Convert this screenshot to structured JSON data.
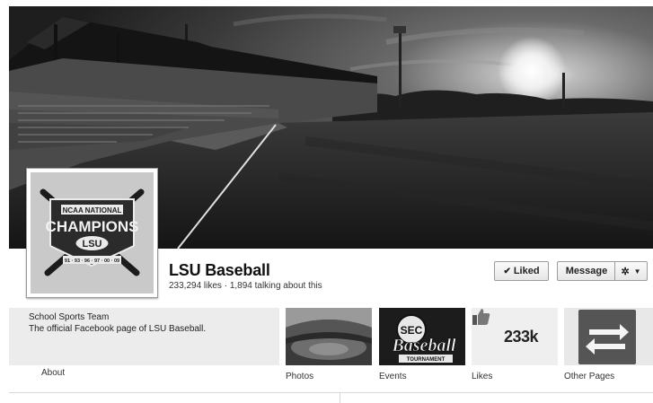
{
  "page": {
    "name": "LSU Baseball",
    "stats": "233,294 likes · 1,894 talking about this"
  },
  "profile_picture": {
    "top_text": "NCAA NATIONAL",
    "main_text": "CHAMPIONS",
    "school_text": "LSU",
    "years_text": "91 · 93 · 96 · 97 · 00 · 09"
  },
  "actions": {
    "liked_label": "Liked",
    "message_label": "Message",
    "gear_icon": "gear-icon",
    "dropdown_icon": "caret-down-icon"
  },
  "about": {
    "category": "School Sports Team",
    "description": "The official Facebook page of LSU Baseball.",
    "link_label": "About"
  },
  "apps": {
    "photos_label": "Photos",
    "events_label": "Events",
    "events_logo_top": "SEC",
    "events_logo_main": "Baseball",
    "events_logo_bottom": "TOURNAMENT",
    "likes_label": "Likes",
    "likes_count": "233k",
    "other_label": "Other Pages"
  }
}
